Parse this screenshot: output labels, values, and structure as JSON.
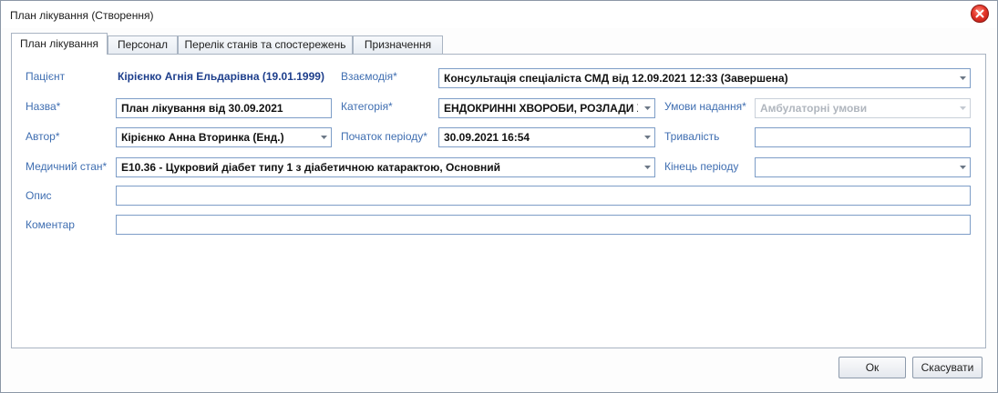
{
  "window": {
    "title": "План лікування (Створення)"
  },
  "tabs": [
    {
      "label": "План лікування",
      "active": true
    },
    {
      "label": "Персонал",
      "active": false
    },
    {
      "label": "Перелік станів та спостережень",
      "active": false
    },
    {
      "label": "Призначення",
      "active": false
    }
  ],
  "form": {
    "patient": {
      "label": "Пацієнт",
      "value": "Кірієнко Агнія Ельдарівна (19.01.1999)"
    },
    "interaction": {
      "label": "Взаємодія*",
      "value": "Консультація спеціаліста СМД від 12.09.2021 12:33 (Завершена)"
    },
    "name": {
      "label": "Назва*",
      "value": "План лікування від 30.09.2021"
    },
    "category": {
      "label": "Категорія*",
      "value": "ЕНДОКРИННІ ХВОРОБИ, РОЗЛАДИ ХАРЧУВАННЯ"
    },
    "conditions": {
      "label": "Умови надання*",
      "value": "Амбулаторні умови",
      "disabled": true
    },
    "author": {
      "label": "Автор*",
      "value": "Кірієнко Анна Вторинка (Енд.)"
    },
    "period_start": {
      "label": "Початок періоду*",
      "value": "30.09.2021 16:54"
    },
    "duration": {
      "label": "Тривалість",
      "value": ""
    },
    "medical_condition": {
      "label": "Медичний стан*",
      "value": "E10.36 - Цукровий діабет типу 1 з діабетичною катарактою, Основний"
    },
    "period_end": {
      "label": "Кінець періоду",
      "value": ""
    },
    "description": {
      "label": "Опис",
      "value": ""
    },
    "comment": {
      "label": "Коментар",
      "value": ""
    }
  },
  "buttons": {
    "ok": "Ок",
    "cancel": "Скасувати"
  },
  "colors": {
    "label": "#3f6eb1",
    "patient": "#1e3f8c",
    "field_border": "#7d9dc7",
    "close": "#e4362a"
  }
}
